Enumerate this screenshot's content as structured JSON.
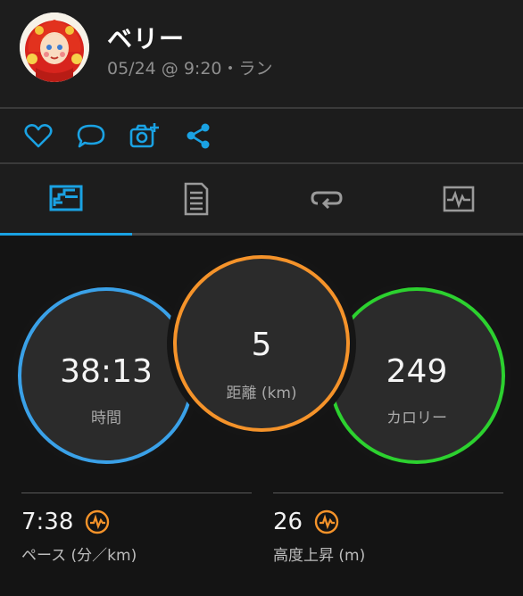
{
  "header": {
    "user_name": "ベリー",
    "meta": "05/24 @ 9:20・ラン"
  },
  "actions": [
    "heart-icon",
    "comment-icon",
    "camera-add-icon",
    "share-icon"
  ],
  "tabs": {
    "active_index": 0,
    "icons": [
      "stats-icon",
      "details-icon",
      "laps-icon",
      "chart-icon"
    ]
  },
  "colors": {
    "accent": "#1aa2e3",
    "time_ring": "#3aa1e8",
    "distance_ring": "#f5932a",
    "calorie_ring": "#2cd12f"
  },
  "circles": {
    "time": {
      "value": "38:13",
      "label": "時間"
    },
    "distance": {
      "value": "5",
      "label": "距離 (km)"
    },
    "calories": {
      "value": "249",
      "label": "カロリー"
    }
  },
  "metrics": {
    "pace": {
      "value": "7:38",
      "label": "ペース (分／km)"
    },
    "elevation": {
      "value": "26",
      "label": "高度上昇 (m)"
    }
  }
}
